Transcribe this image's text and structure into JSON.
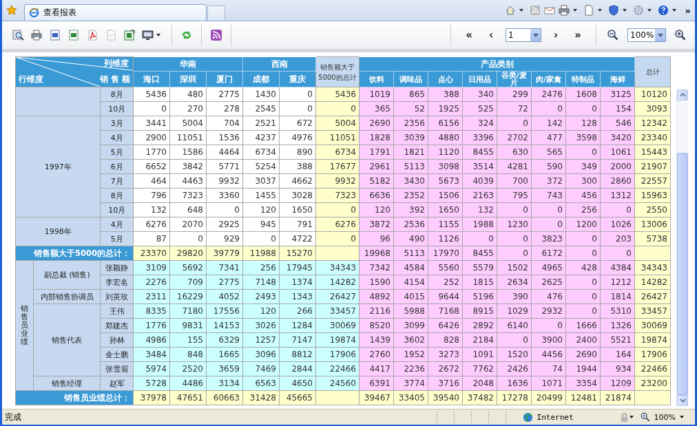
{
  "browser": {
    "tab_title": "查看报表",
    "more": "»"
  },
  "toolbar": {
    "first": "«",
    "prev": "‹",
    "page": "1",
    "next": "›",
    "last": "»",
    "zoom": "100%"
  },
  "report": {
    "corner": {
      "column_dimension": "列维度",
      "measure": "销 售 额",
      "row_dimension": "行维度"
    },
    "region_groups": [
      {
        "name": "华南",
        "columns": [
          "海口",
          "深圳",
          "厦门"
        ]
      },
      {
        "name": "西南",
        "columns": [
          "成都",
          "重庆"
        ]
      }
    ],
    "over5000_header": "销售额大于5000的总计",
    "category_header": {
      "name": "产品类别",
      "columns": [
        "饮料",
        "调味品",
        "点心",
        "日用品",
        "谷类/麦片",
        "肉/家禽",
        "特制品",
        "海鲜"
      ]
    },
    "total_header": "总计",
    "sections": [
      {
        "kind": "time",
        "groups": [
          {
            "rows": [
              {
                "label": "8月",
                "regions": [
                  "5436",
                  "480",
                  "2775",
                  "1430",
                  "0"
                ],
                "over5000": "5436",
                "products": [
                  "1019",
                  "865",
                  "388",
                  "340",
                  "299",
                  "2476",
                  "1608",
                  "3125"
                ],
                "total": "10120"
              },
              {
                "label": "10月",
                "regions": [
                  "0",
                  "270",
                  "278",
                  "2545",
                  "0"
                ],
                "over5000": "0",
                "products": [
                  "365",
                  "52",
                  "1925",
                  "525",
                  "72",
                  "0",
                  "0",
                  "154"
                ],
                "total": "3093"
              }
            ]
          },
          {
            "label": "1997年",
            "rows": [
              {
                "label": "3月",
                "regions": [
                  "3441",
                  "5004",
                  "704",
                  "2521",
                  "672"
                ],
                "over5000": "5004",
                "products": [
                  "2690",
                  "2356",
                  "6156",
                  "324",
                  "0",
                  "142",
                  "128",
                  "546"
                ],
                "total": "12342"
              },
              {
                "label": "4月",
                "regions": [
                  "2900",
                  "11051",
                  "1536",
                  "4237",
                  "4976"
                ],
                "over5000": "11051",
                "products": [
                  "1828",
                  "3039",
                  "4880",
                  "3396",
                  "2702",
                  "477",
                  "3598",
                  "3420"
                ],
                "total": "23340"
              },
              {
                "label": "5月",
                "regions": [
                  "1770",
                  "1586",
                  "4464",
                  "6734",
                  "890"
                ],
                "over5000": "6734",
                "products": [
                  "1791",
                  "1821",
                  "1120",
                  "8455",
                  "630",
                  "565",
                  "0",
                  "1061"
                ],
                "total": "15443"
              },
              {
                "label": "6月",
                "regions": [
                  "6652",
                  "3842",
                  "5771",
                  "5254",
                  "388"
                ],
                "over5000": "17677",
                "products": [
                  "2961",
                  "5113",
                  "3098",
                  "3514",
                  "4281",
                  "590",
                  "349",
                  "2000"
                ],
                "total": "21907"
              },
              {
                "label": "7月",
                "regions": [
                  "464",
                  "4463",
                  "9932",
                  "3037",
                  "4662"
                ],
                "over5000": "9932",
                "products": [
                  "5182",
                  "3430",
                  "5673",
                  "4039",
                  "700",
                  "372",
                  "300",
                  "2860"
                ],
                "total": "22557"
              },
              {
                "label": "8月",
                "regions": [
                  "796",
                  "7323",
                  "3360",
                  "1455",
                  "3028"
                ],
                "over5000": "7323",
                "products": [
                  "6636",
                  "2352",
                  "1506",
                  "2163",
                  "795",
                  "743",
                  "456",
                  "1312"
                ],
                "total": "15963"
              },
              {
                "label": "10月",
                "regions": [
                  "132",
                  "648",
                  "0",
                  "120",
                  "1650"
                ],
                "over5000": "0",
                "products": [
                  "120",
                  "392",
                  "1650",
                  "132",
                  "0",
                  "0",
                  "256",
                  "0"
                ],
                "total": "2550"
              }
            ]
          },
          {
            "label": "1998年",
            "rows": [
              {
                "label": "4月",
                "regions": [
                  "6276",
                  "2070",
                  "2925",
                  "945",
                  "791"
                ],
                "over5000": "6276",
                "products": [
                  "3872",
                  "2536",
                  "1155",
                  "1988",
                  "1230",
                  "0",
                  "1200",
                  "1026"
                ],
                "total": "13006"
              },
              {
                "label": "5月",
                "regions": [
                  "87",
                  "0",
                  "929",
                  "0",
                  "4722"
                ],
                "over5000": "0",
                "products": [
                  "96",
                  "490",
                  "1126",
                  "0",
                  "0",
                  "3823",
                  "0",
                  "203"
                ],
                "total": "5738"
              }
            ]
          }
        ],
        "summary": {
          "label": "销售额大于5000的总计：",
          "regions": [
            "23370",
            "29820",
            "39779",
            "11988",
            "15270"
          ],
          "products": [
            "19968",
            "5113",
            "17970",
            "8455",
            "0",
            "6172",
            "0",
            "0"
          ]
        }
      },
      {
        "kind": "staff",
        "label": "销售员业绩",
        "groups": [
          {
            "label": "副总裁 (销售)",
            "rows": [
              {
                "label": "张颖静",
                "regions": [
                  "3109",
                  "5692",
                  "7341",
                  "256",
                  "17945"
                ],
                "over5000": "34343",
                "products": [
                  "7342",
                  "4584",
                  "5560",
                  "5579",
                  "1502",
                  "4965",
                  "428",
                  "4384"
                ],
                "total": "34343"
              },
              {
                "label": "李宏名",
                "regions": [
                  "2276",
                  "709",
                  "2775",
                  "7148",
                  "1374"
                ],
                "over5000": "14282",
                "products": [
                  "1590",
                  "4154",
                  "252",
                  "1815",
                  "2634",
                  "2625",
                  "0",
                  "1212"
                ],
                "total": "14282"
              }
            ]
          },
          {
            "label": "内部销售协调员",
            "rows": [
              {
                "label": "刘英玫",
                "regions": [
                  "2311",
                  "16229",
                  "4052",
                  "2493",
                  "1343"
                ],
                "over5000": "26427",
                "products": [
                  "4892",
                  "4015",
                  "9644",
                  "5196",
                  "390",
                  "476",
                  "0",
                  "1814"
                ],
                "total": "26427"
              }
            ]
          },
          {
            "label": "销售代表",
            "rows": [
              {
                "label": "王伟",
                "regions": [
                  "8335",
                  "7180",
                  "17556",
                  "120",
                  "266"
                ],
                "over5000": "33457",
                "products": [
                  "2116",
                  "5988",
                  "7168",
                  "8915",
                  "1029",
                  "2932",
                  "0",
                  "5310"
                ],
                "total": "33457"
              },
              {
                "label": "郑建杰",
                "regions": [
                  "1776",
                  "9831",
                  "14153",
                  "3026",
                  "1284"
                ],
                "over5000": "30069",
                "products": [
                  "8520",
                  "3099",
                  "6426",
                  "2892",
                  "6140",
                  "0",
                  "1666",
                  "1326"
                ],
                "total": "30069"
              },
              {
                "label": "孙林",
                "regions": [
                  "4986",
                  "155",
                  "6329",
                  "1257",
                  "7147"
                ],
                "over5000": "19874",
                "products": [
                  "1439",
                  "3602",
                  "828",
                  "2184",
                  "0",
                  "3900",
                  "2400",
                  "5521"
                ],
                "total": "19874"
              },
              {
                "label": "金士鹏",
                "regions": [
                  "3484",
                  "848",
                  "1665",
                  "3096",
                  "8812"
                ],
                "over5000": "17906",
                "products": [
                  "2760",
                  "1952",
                  "3273",
                  "1091",
                  "1520",
                  "4456",
                  "2690",
                  "164"
                ],
                "total": "17906"
              },
              {
                "label": "张雪眉",
                "regions": [
                  "5974",
                  "2520",
                  "3659",
                  "7469",
                  "2844"
                ],
                "over5000": "22466",
                "products": [
                  "4417",
                  "2236",
                  "2672",
                  "7762",
                  "2426",
                  "74",
                  "1944",
                  "934"
                ],
                "total": "22466"
              }
            ]
          },
          {
            "label": "销售经理",
            "rows": [
              {
                "label": "赵军",
                "regions": [
                  "5728",
                  "4486",
                  "3134",
                  "6563",
                  "4650"
                ],
                "over5000": "24560",
                "products": [
                  "6391",
                  "3774",
                  "3716",
                  "2048",
                  "1636",
                  "1071",
                  "3354",
                  "1209"
                ],
                "total": "23200"
              }
            ]
          }
        ],
        "summary": {
          "label": "销售员业绩总计：",
          "regions": [
            "37978",
            "47651",
            "60663",
            "31428",
            "45665"
          ],
          "products": [
            "39467",
            "33405",
            "39540",
            "37482",
            "17278",
            "20499",
            "12481",
            "21874"
          ]
        }
      }
    ]
  },
  "status_bar": {
    "text": "完成",
    "zone": "Internet",
    "zoom": "100%"
  }
}
